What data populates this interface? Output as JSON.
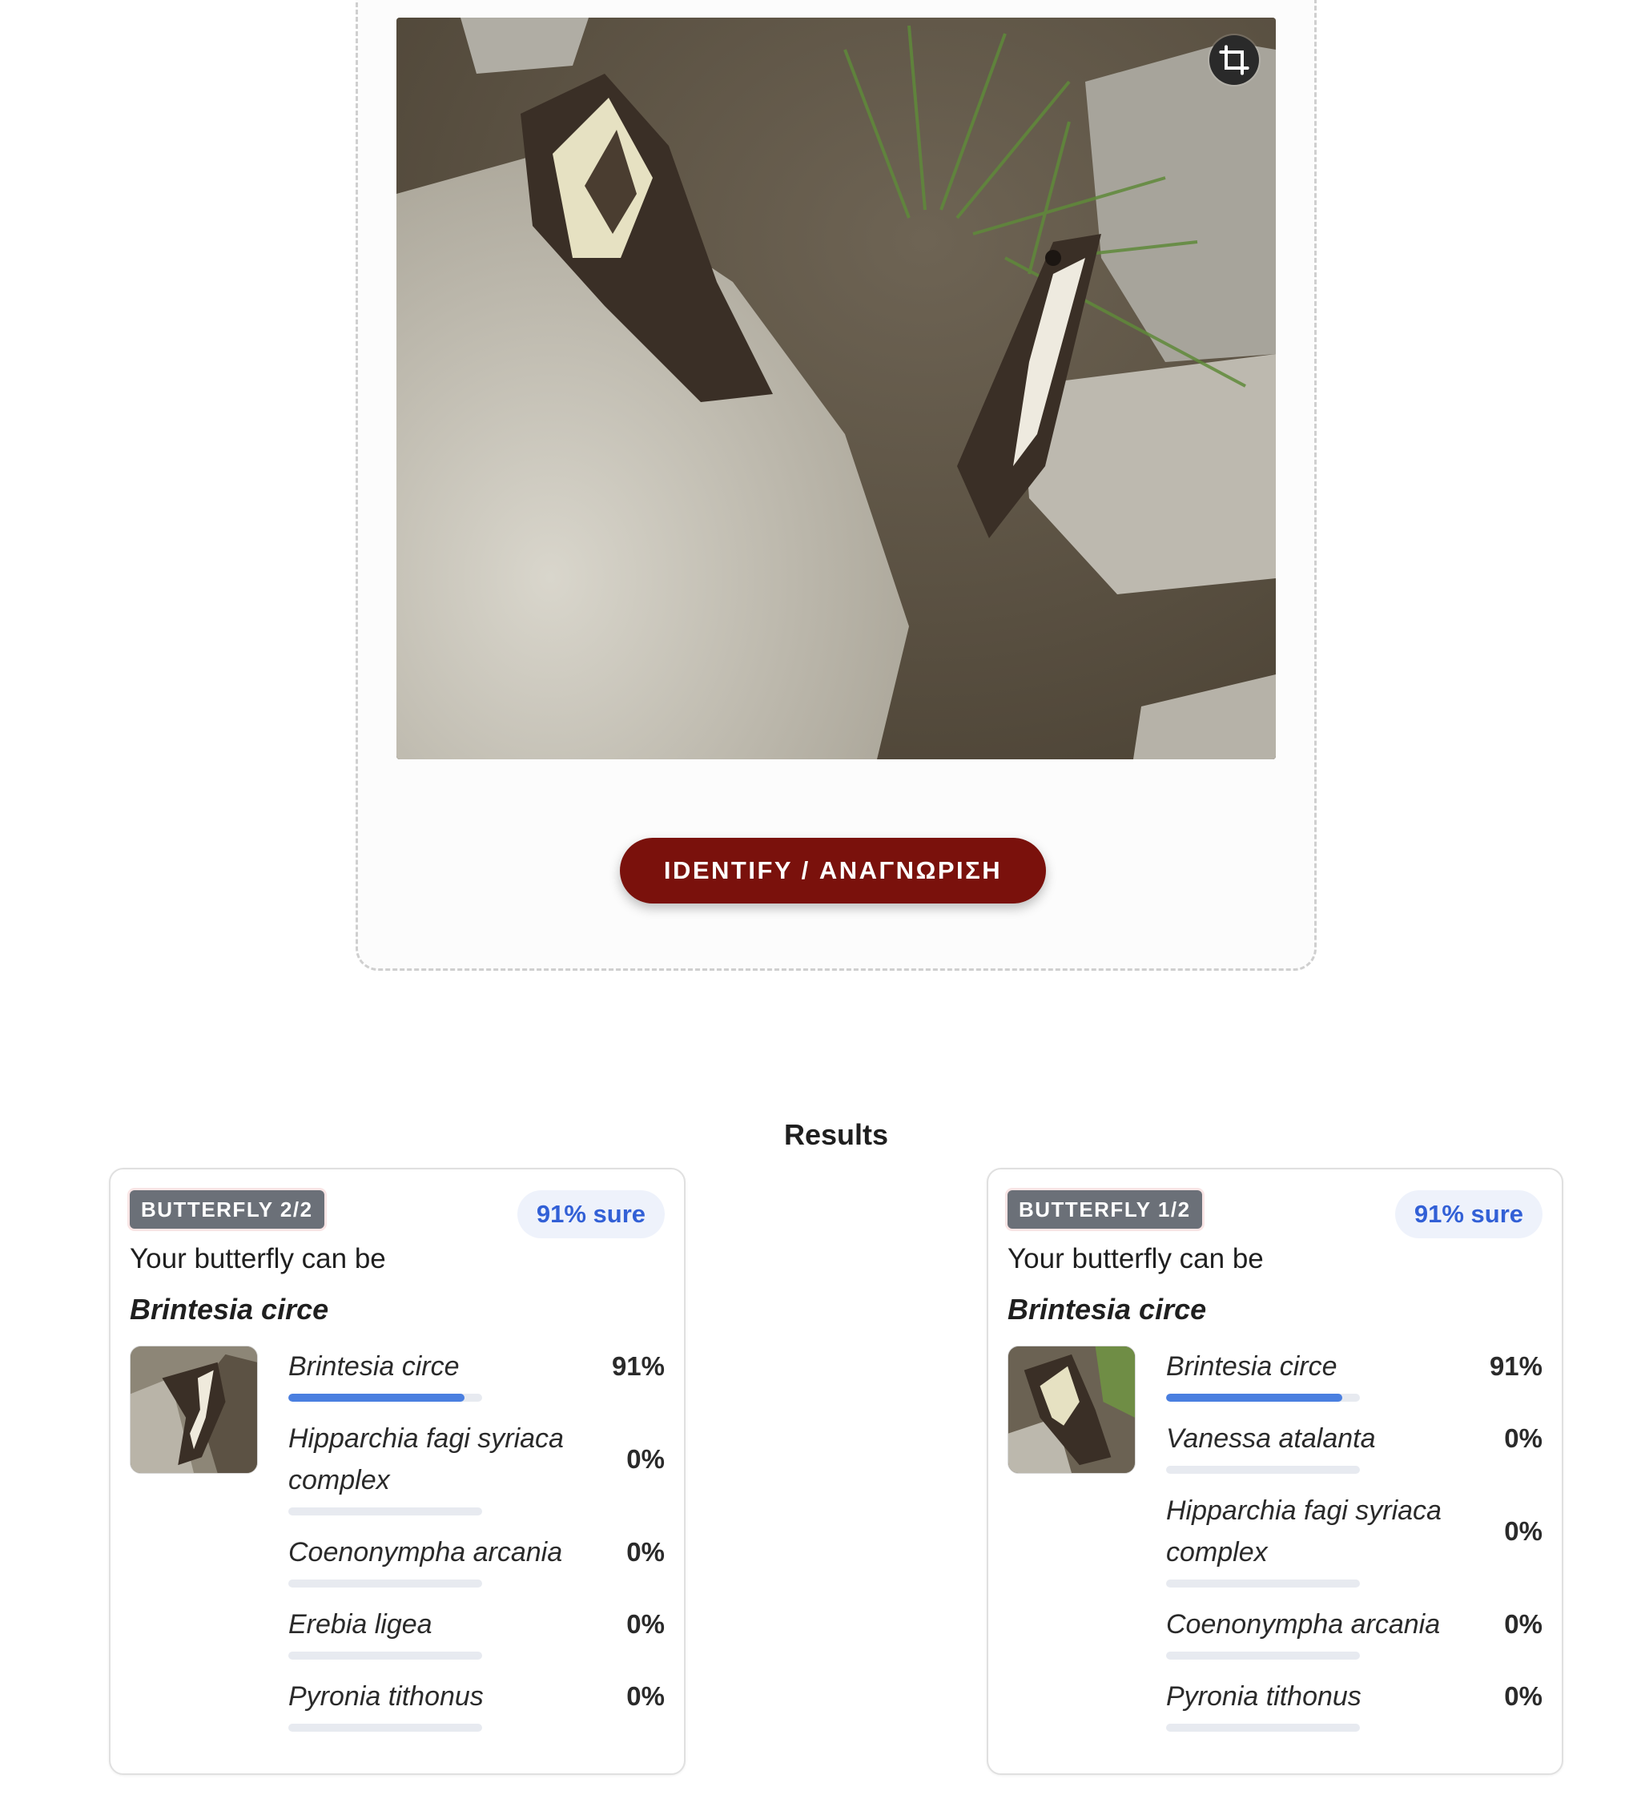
{
  "identify_button": {
    "label": "IDENTIFY / ΑΝΑΓΝΩΡΙΣΗ"
  },
  "results": {
    "title": "Results",
    "cards": [
      {
        "badge": "BUTTERFLY 2/2",
        "sure": "91% sure",
        "intro": "Your butterfly can be",
        "species": "Brintesia circe",
        "predictions": [
          {
            "name": "Brintesia circe",
            "value": "91%",
            "fraction": 0.91
          },
          {
            "name": "Hipparchia fagi syriaca complex",
            "value": "0%",
            "fraction": 0
          },
          {
            "name": "Coenonympha arcania",
            "value": "0%",
            "fraction": 0
          },
          {
            "name": "Erebia ligea",
            "value": "0%",
            "fraction": 0
          },
          {
            "name": "Pyronia tithonus",
            "value": "0%",
            "fraction": 0
          }
        ]
      },
      {
        "badge": "BUTTERFLY 1/2",
        "sure": "91% sure",
        "intro": "Your butterfly can be",
        "species": "Brintesia circe",
        "predictions": [
          {
            "name": "Brintesia circe",
            "value": "91%",
            "fraction": 0.91
          },
          {
            "name": "Vanessa atalanta",
            "value": "0%",
            "fraction": 0
          },
          {
            "name": "Hipparchia fagi syriaca complex",
            "value": "0%",
            "fraction": 0
          },
          {
            "name": "Coenonympha arcania",
            "value": "0%",
            "fraction": 0
          },
          {
            "name": "Pyronia tithonus",
            "value": "0%",
            "fraction": 0
          }
        ]
      }
    ]
  },
  "colors": {
    "accent": "#7a110c",
    "bar": "#4a7fe0",
    "sure_text": "#3260d6"
  },
  "icons": {
    "crop": "crop-icon"
  }
}
